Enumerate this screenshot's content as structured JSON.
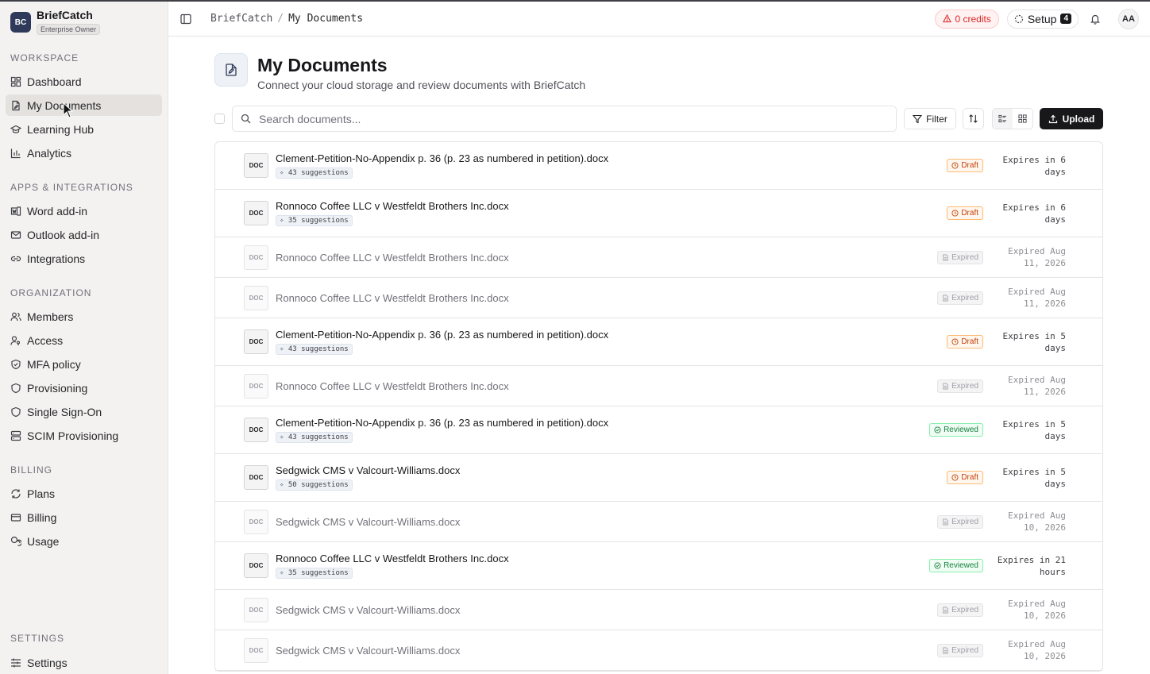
{
  "brand": {
    "logo": "BC",
    "name": "BriefCatch",
    "role": "Enterprise Owner"
  },
  "sidebar": {
    "sections": [
      {
        "title": "WORKSPACE",
        "items": [
          {
            "label": "Dashboard",
            "icon": "dashboard-icon"
          },
          {
            "label": "My Documents",
            "icon": "document-icon",
            "active": true
          },
          {
            "label": "Learning Hub",
            "icon": "graduation-cap-icon"
          },
          {
            "label": "Analytics",
            "icon": "bar-chart-icon"
          }
        ]
      },
      {
        "title": "APPS & INTEGRATIONS",
        "items": [
          {
            "label": "Word add-in",
            "icon": "word-icon"
          },
          {
            "label": "Outlook add-in",
            "icon": "mail-icon"
          },
          {
            "label": "Integrations",
            "icon": "link-icon"
          }
        ]
      },
      {
        "title": "ORGANIZATION",
        "items": [
          {
            "label": "Members",
            "icon": "users-icon"
          },
          {
            "label": "Access",
            "icon": "user-key-icon"
          },
          {
            "label": "MFA policy",
            "icon": "shield-check-icon"
          },
          {
            "label": "Provisioning",
            "icon": "shield-icon"
          },
          {
            "label": "Single Sign-On",
            "icon": "shield-icon"
          },
          {
            "label": "SCIM Provisioning",
            "icon": "server-icon"
          }
        ]
      },
      {
        "title": "BILLING",
        "items": [
          {
            "label": "Plans",
            "icon": "refresh-icon"
          },
          {
            "label": "Billing",
            "icon": "credit-card-icon"
          },
          {
            "label": "Usage",
            "icon": "coins-icon"
          }
        ]
      }
    ],
    "settings": {
      "title": "SETTINGS",
      "label": "Settings",
      "icon": "sliders-icon"
    }
  },
  "topbar": {
    "breadcrumb": {
      "root": "BriefCatch",
      "separator": "/",
      "current": "My Documents"
    },
    "credits": "0 credits",
    "setup": {
      "label": "Setup",
      "count": "4"
    },
    "avatar": "AA"
  },
  "page": {
    "title": "My Documents",
    "subtitle": "Connect your cloud storage and review documents with BriefCatch"
  },
  "toolbar": {
    "search_placeholder": "Search documents...",
    "filter_label": "Filter",
    "upload_label": "Upload"
  },
  "documents": [
    {
      "icon": "DOC",
      "name": "Clement-Petition-No-Appendix p. 36 (p. 23 as numbered in petition).docx",
      "suggestions": "43 suggestions",
      "status": "Draft",
      "status_type": "draft",
      "expiry_line1": "Expires in 6",
      "expiry_line2": "days"
    },
    {
      "icon": "DOC",
      "name": "Ronnoco Coffee LLC v Westfeldt Brothers Inc.docx",
      "suggestions": "35 suggestions",
      "status": "Draft",
      "status_type": "draft",
      "expiry_line1": "Expires in 6",
      "expiry_line2": "days"
    },
    {
      "icon": "DOC",
      "name": "Ronnoco Coffee LLC v Westfeldt Brothers Inc.docx",
      "suggestions": "",
      "status": "Expired",
      "status_type": "expired",
      "expiry_line1": "Expired Aug",
      "expiry_line2": "11, 2026"
    },
    {
      "icon": "DOC",
      "name": "Ronnoco Coffee LLC v Westfeldt Brothers Inc.docx",
      "suggestions": "",
      "status": "Expired",
      "status_type": "expired",
      "expiry_line1": "Expired Aug",
      "expiry_line2": "11, 2026"
    },
    {
      "icon": "DOC",
      "name": "Clement-Petition-No-Appendix p. 36 (p. 23 as numbered in petition).docx",
      "suggestions": "43 suggestions",
      "status": "Draft",
      "status_type": "draft",
      "expiry_line1": "Expires in 5",
      "expiry_line2": "days"
    },
    {
      "icon": "DOC",
      "name": "Ronnoco Coffee LLC v Westfeldt Brothers Inc.docx",
      "suggestions": "",
      "status": "Expired",
      "status_type": "expired",
      "expiry_line1": "Expired Aug",
      "expiry_line2": "11, 2026"
    },
    {
      "icon": "DOC",
      "name": "Clement-Petition-No-Appendix p. 36 (p. 23 as numbered in petition).docx",
      "suggestions": "43 suggestions",
      "status": "Reviewed",
      "status_type": "reviewed",
      "expiry_line1": "Expires in 5",
      "expiry_line2": "days"
    },
    {
      "icon": "DOC",
      "name": "Sedgwick CMS v Valcourt-Williams.docx",
      "suggestions": "50 suggestions",
      "status": "Draft",
      "status_type": "draft",
      "expiry_line1": "Expires in 5",
      "expiry_line2": "days"
    },
    {
      "icon": "DOC",
      "name": "Sedgwick CMS v Valcourt-Williams.docx",
      "suggestions": "",
      "status": "Expired",
      "status_type": "expired",
      "expiry_line1": "Expired Aug",
      "expiry_line2": "10, 2026"
    },
    {
      "icon": "DOC",
      "name": "Ronnoco Coffee LLC v Westfeldt Brothers Inc.docx",
      "suggestions": "35 suggestions",
      "status": "Reviewed",
      "status_type": "reviewed",
      "expiry_line1": "Expires in 21",
      "expiry_line2": "hours"
    },
    {
      "icon": "DOC",
      "name": "Sedgwick CMS v Valcourt-Williams.docx",
      "suggestions": "",
      "status": "Expired",
      "status_type": "expired",
      "expiry_line1": "Expired Aug",
      "expiry_line2": "10, 2026"
    },
    {
      "icon": "DOC",
      "name": "Sedgwick CMS v Valcourt-Williams.docx",
      "suggestions": "",
      "status": "Expired",
      "status_type": "expired",
      "expiry_line1": "Expired Aug",
      "expiry_line2": "10, 2026"
    }
  ],
  "colors": {
    "accent": "#18181b",
    "draft": "#c2410c",
    "reviewed": "#15803d",
    "credits_warning": "#dc2626"
  }
}
